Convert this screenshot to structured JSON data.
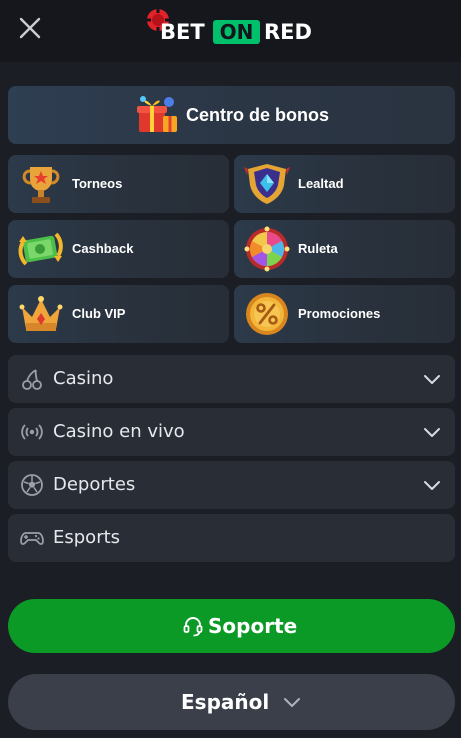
{
  "header": {
    "logo_bet": "BET",
    "logo_on": "ON",
    "logo_red": "RED"
  },
  "bonus_center": {
    "label": "Centro de bonos",
    "icon": "gift-icon"
  },
  "tiles": [
    {
      "label": "Torneos",
      "icon": "trophy-icon"
    },
    {
      "label": "Lealtad",
      "icon": "loyalty-shield-icon"
    },
    {
      "label": "Cashback",
      "icon": "cashback-icon"
    },
    {
      "label": "Ruleta",
      "icon": "roulette-wheel-icon"
    },
    {
      "label": "Club VIP",
      "icon": "crown-icon"
    },
    {
      "label": "Promociones",
      "icon": "percent-coin-icon"
    }
  ],
  "menu": [
    {
      "label": "Casino",
      "icon": "cherry-icon"
    },
    {
      "label": "Casino en vivo",
      "icon": "live-broadcast-icon"
    },
    {
      "label": "Deportes",
      "icon": "soccer-ball-icon"
    },
    {
      "label": "Esports",
      "icon": "gamepad-icon"
    }
  ],
  "support": {
    "label": "Soporte",
    "icon": "headset-icon"
  },
  "language": {
    "label": "Español"
  },
  "colors": {
    "background": "#1b1e24",
    "header": "#15171c",
    "brand_green": "#00c06b",
    "support_green": "#0b9a26",
    "row_bg": "#292d36",
    "lang_bg": "#3a3f49"
  }
}
